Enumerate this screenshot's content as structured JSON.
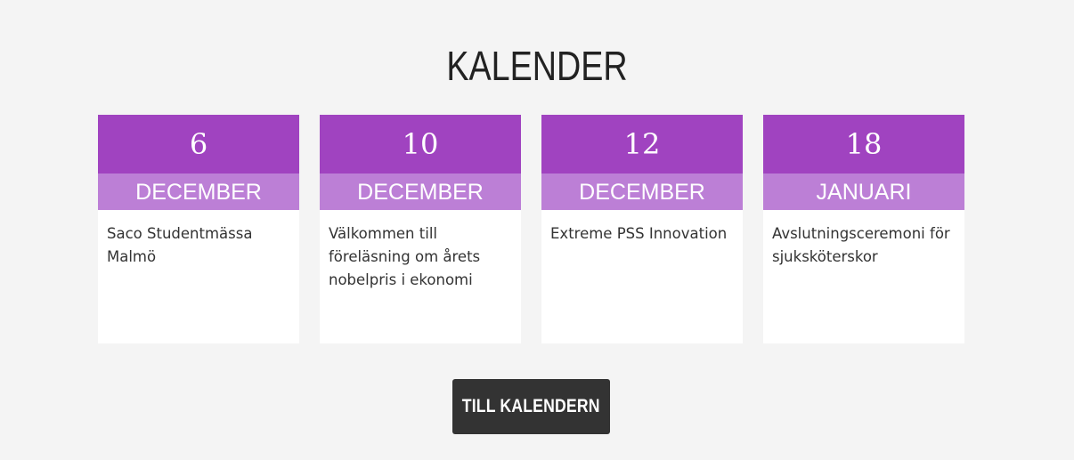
{
  "section": {
    "title": "KALENDER"
  },
  "events": [
    {
      "day": "6",
      "month": "DECEMBER",
      "title": "Saco Studentmässa Malmö"
    },
    {
      "day": "10",
      "month": "DECEMBER",
      "title": "Välkommen till föreläsning om årets nobelpris i ekonomi"
    },
    {
      "day": "12",
      "month": "DECEMBER",
      "title": "Extreme PSS Innovation"
    },
    {
      "day": "18",
      "month": "JANUARI",
      "title": "Avslutningsceremoni för sjuksköterskor"
    }
  ],
  "cta": {
    "label": "TILL KALENDERN"
  },
  "colors": {
    "background": "#f4f4f4",
    "day_header": "#a043c0",
    "month_band": "#bc7fd6",
    "card_body": "#ffffff",
    "cta_background": "#333333"
  }
}
